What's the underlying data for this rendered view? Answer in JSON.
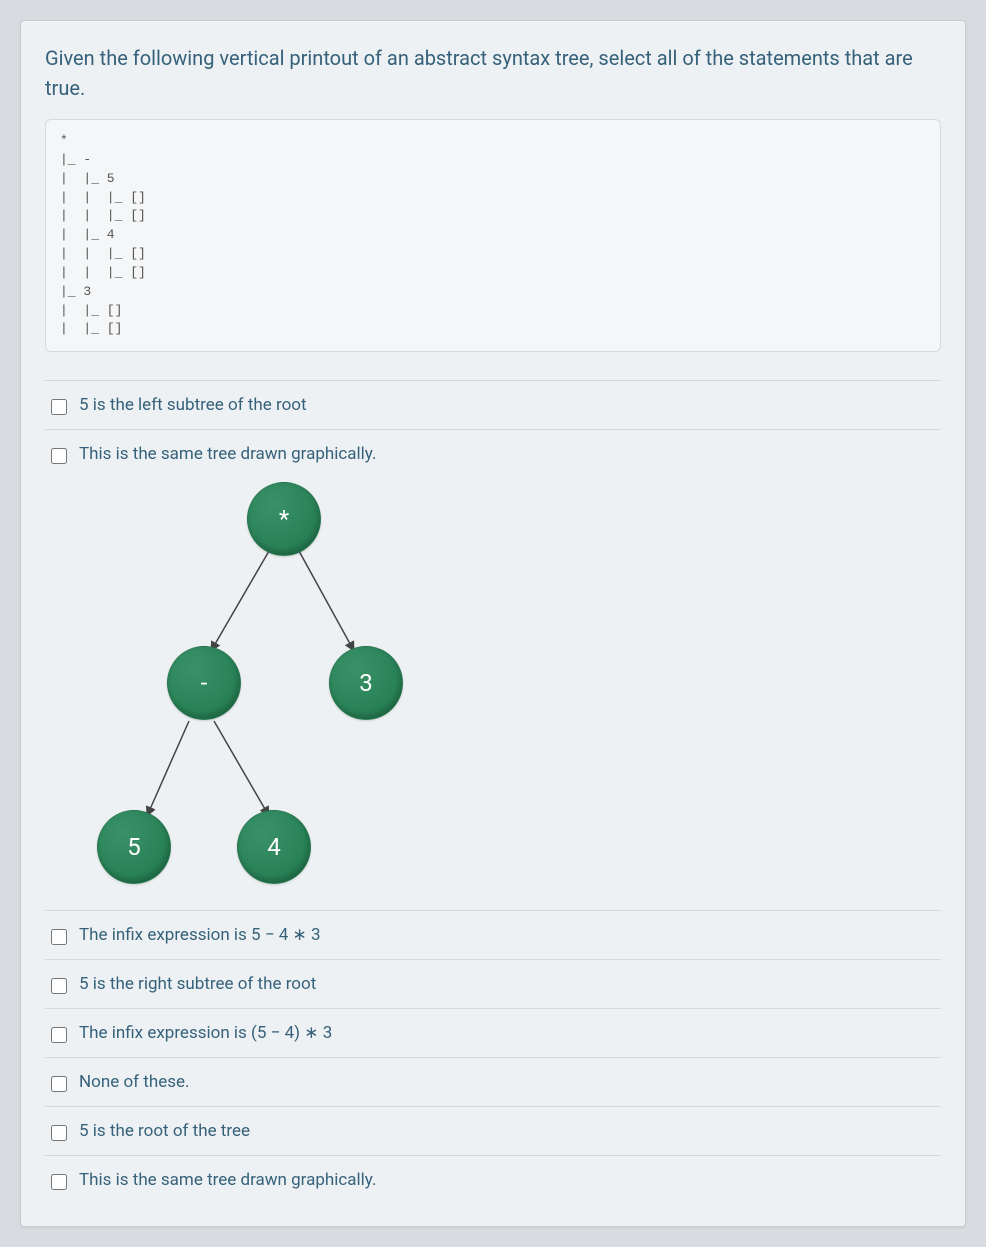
{
  "prompt": "Given the following vertical printout of an abstract syntax tree, select all of the statements that are true.",
  "tree_printout": "*\n|_ -\n|  |_ 5\n|  |  |_ []\n|  |  |_ []\n|  |_ 4\n|  |  |_ []\n|  |  |_ []\n|_ 3\n|  |_ []\n|  |_ []",
  "options": [
    {
      "label": "5 is the left subtree of the root",
      "has_tree": false
    },
    {
      "label": "This is the same tree drawn graphically.",
      "has_tree": true
    },
    {
      "label": "The infix expression is 5 − 4 ∗ 3",
      "has_tree": false
    },
    {
      "label": "5 is the right subtree of the root",
      "has_tree": false
    },
    {
      "label": "The infix expression is (5 − 4) ∗ 3",
      "has_tree": false
    },
    {
      "label": "None of these.",
      "has_tree": false
    },
    {
      "label": "5 is the root of the tree",
      "has_tree": false
    },
    {
      "label": "This is the same tree drawn graphically.",
      "has_tree": false
    }
  ],
  "tree_nodes": {
    "root": "*",
    "left": "-",
    "right": "3",
    "leftleft": "5",
    "leftright": "4"
  }
}
